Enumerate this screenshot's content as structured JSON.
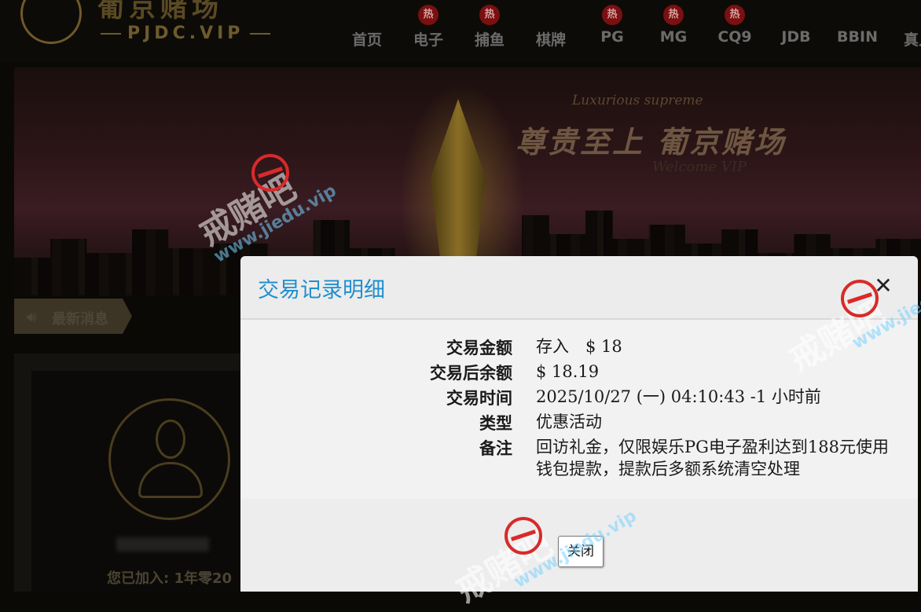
{
  "header": {
    "logo_title": "葡京赌场",
    "logo_subtitle": "PJDC.VIP",
    "nav_items": [
      {
        "label": "首页",
        "hot": false
      },
      {
        "label": "电子",
        "hot": true
      },
      {
        "label": "捕鱼",
        "hot": true
      },
      {
        "label": "棋牌",
        "hot": false
      },
      {
        "label": "PG",
        "hot": true
      },
      {
        "label": "MG",
        "hot": true
      },
      {
        "label": "CQ9",
        "hot": true
      },
      {
        "label": "JDB",
        "hot": false
      },
      {
        "label": "BBIN",
        "hot": false
      },
      {
        "label": "真人",
        "hot": false
      }
    ],
    "hot_badge": "热"
  },
  "banner": {
    "english_line": "Luxurious supreme",
    "title": "尊贵至上 葡京赌场",
    "welcome": "Welcome VIP"
  },
  "news": {
    "label": "最新消息",
    "icon": "speaker-icon"
  },
  "profile": {
    "join_text": "您已加入: 1年零20"
  },
  "modal": {
    "title": "交易记录明细",
    "close_icon": "✕",
    "rows": [
      {
        "label": "交易金额",
        "value": "存入　$ 18"
      },
      {
        "label": "交易后余额",
        "value": "$ 18.19"
      },
      {
        "label": "交易时间",
        "value": "2025/10/27 (一) 04:10:43 -1 小时前"
      },
      {
        "label": "类型",
        "value": "优惠活动"
      },
      {
        "label": "备注",
        "value": "回访礼金，仅限娱乐PG电子盈利达到188元使用钱包提款，提款后多额系统清空处理"
      }
    ],
    "close_button": "关闭"
  },
  "watermark": {
    "text": "戒赌吧",
    "url": "www.jiedu.vip"
  },
  "colors": {
    "modal_title": "#1f8fcf",
    "background": "#0b0906",
    "gold_dim": "#6f5a2a",
    "ban_red": "#d82a2a"
  }
}
